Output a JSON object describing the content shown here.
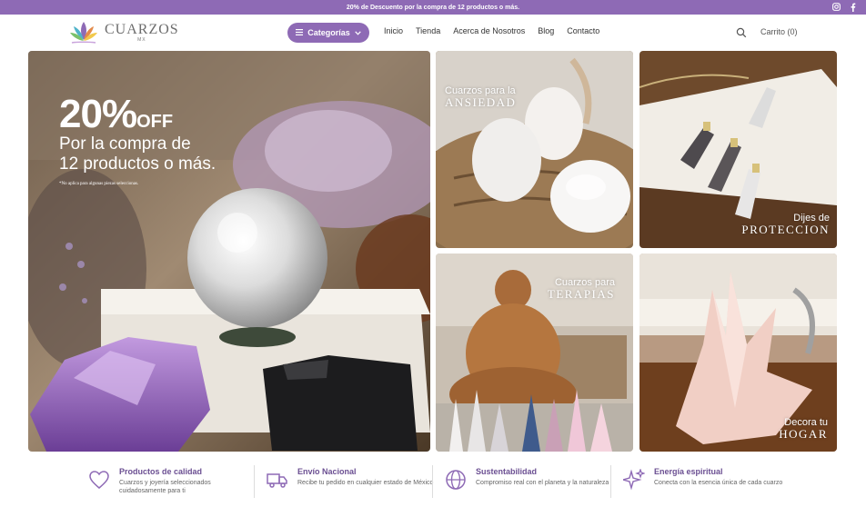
{
  "topbar": {
    "promo": "20% de Descuento por la compra de 12 productos o más.",
    "social": [
      {
        "icon": "instagram-icon",
        "glyph": "◎"
      },
      {
        "icon": "facebook-icon",
        "glyph": "f"
      }
    ]
  },
  "header": {
    "logo_text": "CUARZOS",
    "logo_sub": "MX",
    "categories_label": "Categorías",
    "nav": [
      "Inicio",
      "Tienda",
      "Acerca de Nosotros",
      "Blog",
      "Contacto"
    ],
    "cart_label": "Carrito (0)"
  },
  "hero": {
    "percent": "20%",
    "off": "OFF",
    "line1": "Por la compra de",
    "line2": "12 productos o más.",
    "note": "*No aplica para algunas piezas seleccionas."
  },
  "tiles": [
    {
      "line1": "Cuarzos para la",
      "line2": "ANSIEDAD"
    },
    {
      "line1": "Dijes de",
      "line2": "PROTECCION"
    },
    {
      "line1": "Cuarzos para",
      "line2": "TERAPIAS"
    },
    {
      "line1": "Decora tu",
      "line2": "HOGAR"
    }
  ],
  "features": [
    {
      "icon": "heart-icon",
      "title": "Productos de calidad",
      "desc": "Cuarzos y joyería seleccionados cuidadosamente para ti"
    },
    {
      "icon": "truck-icon",
      "title": "Envío Nacional",
      "desc": "Recibe tu pedido en cualquier estado de México"
    },
    {
      "icon": "globe-icon",
      "title": "Sustentabilidad",
      "desc": "Compromiso real con el planeta y la naturaleza"
    },
    {
      "icon": "sparkles-icon",
      "title": "Energía espiritual",
      "desc": "Conecta con la esencia única de cada cuarzo"
    }
  ],
  "colors": {
    "brand_purple": "#8e6ab5",
    "feature_title": "#6b4f92"
  }
}
